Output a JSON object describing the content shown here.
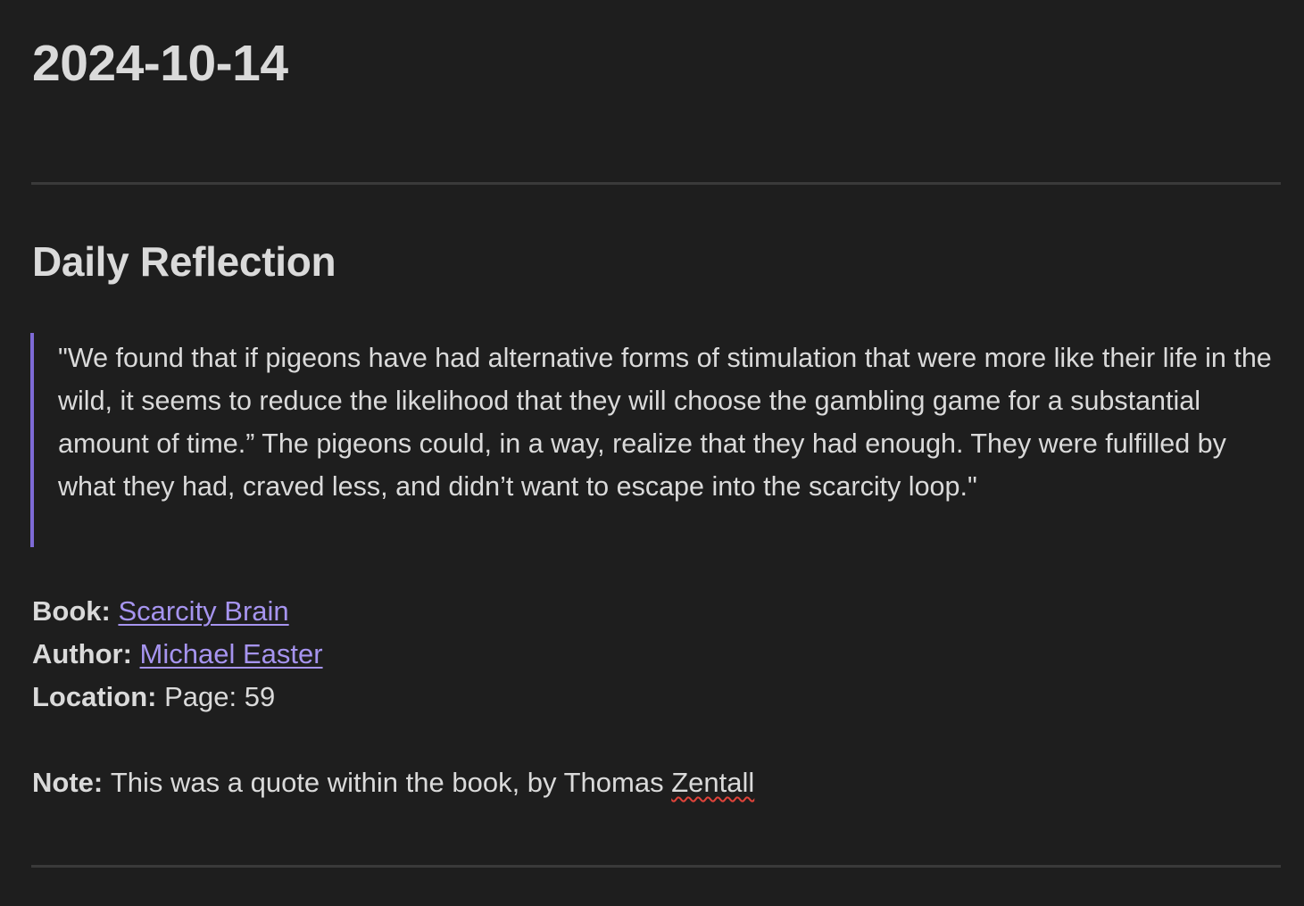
{
  "document": {
    "title": "2024-10-14"
  },
  "reflection": {
    "heading": "Daily Reflection",
    "quote": "\"We found that if pigeons have had alternative forms of stimulation that were more like their life in the wild, it seems to reduce the likelihood that they will choose the gambling game for a substantial amount of time.” The pigeons could, in a way, realize that they had enough. They were fulfilled by what they had, craved less, and didn’t want to escape into the scarcity loop.\"",
    "book_label": "Book:",
    "book_link": "Scarcity Brain",
    "author_label": "Author:",
    "author_link": "Michael Easter",
    "location_label": "Location:",
    "location_value": "Page: 59",
    "note_label": "Note:",
    "note_text": "This was a quote within the book, by Thomas ",
    "note_name": "Zentall"
  },
  "colors": {
    "background": "#1e1e1e",
    "text": "#dadada",
    "link": "#a694ef",
    "blockquote_accent": "#7e6ad6",
    "spellcheck": "#e0433a"
  }
}
